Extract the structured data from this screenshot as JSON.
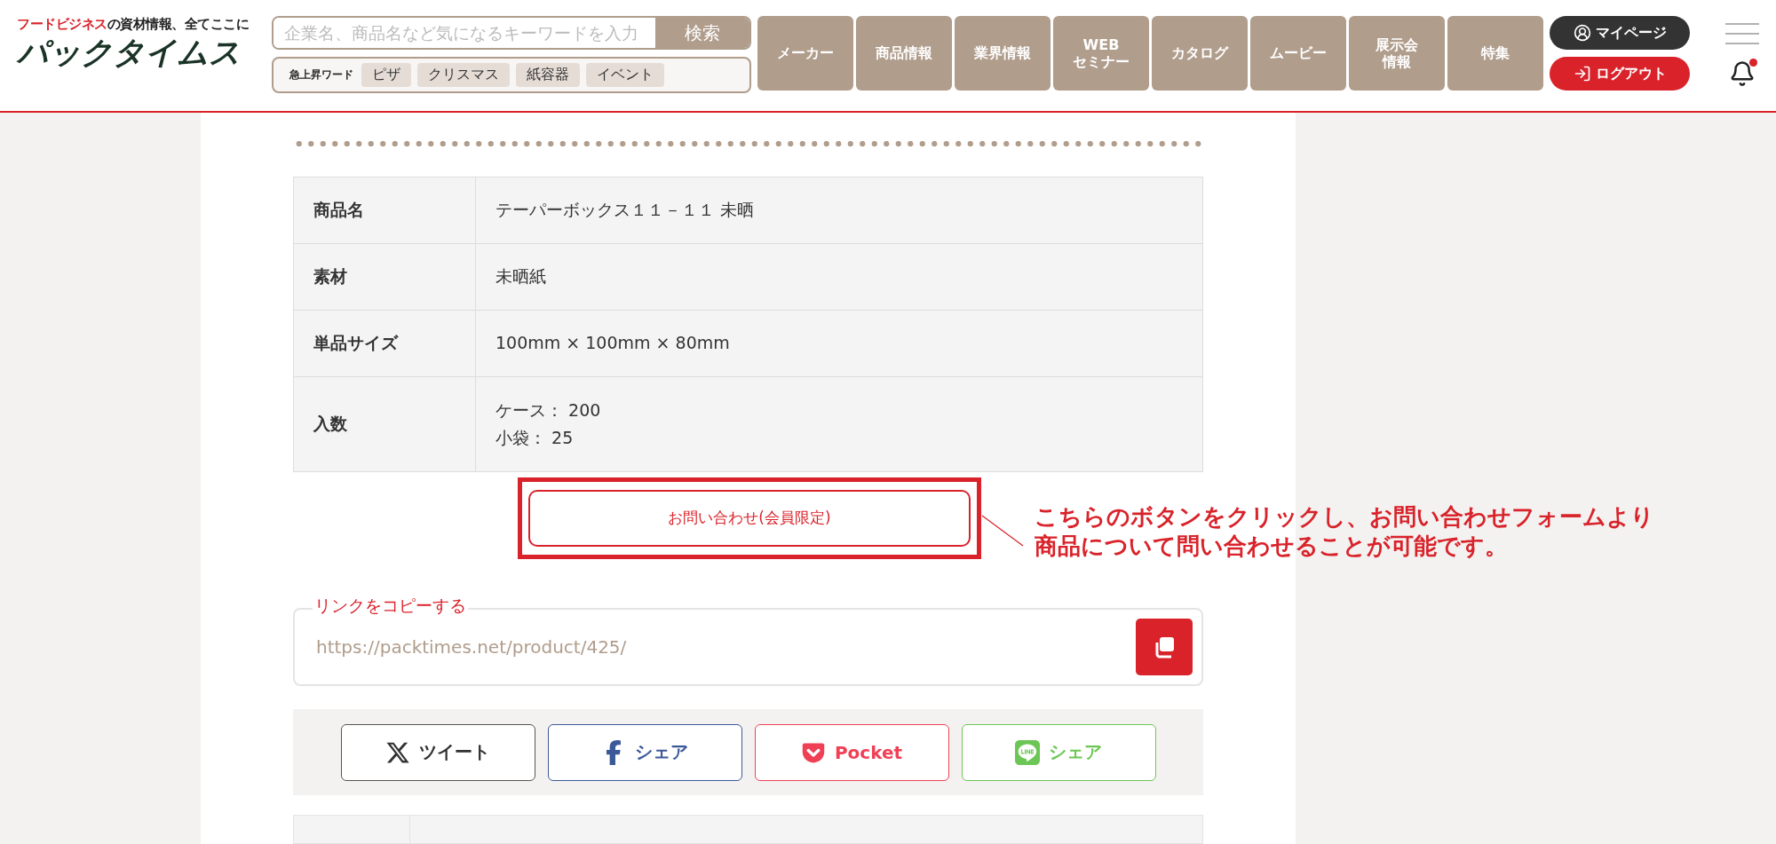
{
  "header": {
    "logo": {
      "tagline_accent": "フードビジネス",
      "tagline_rest": "の資材情報、全てここに",
      "name": "パックタイムス"
    },
    "search": {
      "placeholder": "企業名、商品名など気になるキーワードを入力",
      "button": "検索"
    },
    "trending": {
      "label": "急上昇ワード",
      "words": [
        "ピザ",
        "クリスマス",
        "紙容器",
        "イベント"
      ]
    },
    "nav": [
      [
        "メーカー"
      ],
      [
        "商品情報"
      ],
      [
        "業界情報"
      ],
      [
        "WEB",
        "セミナー"
      ],
      [
        "カタログ"
      ],
      [
        "ムービー"
      ],
      [
        "展示会",
        "情報"
      ],
      [
        "特集"
      ]
    ],
    "mypage": "マイページ",
    "logout": "ログアウト",
    "notification_unread": true
  },
  "details": [
    {
      "label": "商品名",
      "lines": [
        "テーパーボックス１１－１１ 未晒"
      ]
    },
    {
      "label": "素材",
      "lines": [
        "未晒紙"
      ]
    },
    {
      "label": "単品サイズ",
      "lines": [
        "100mm × 100mm × 80mm"
      ]
    },
    {
      "label": "入数",
      "lines": [
        "ケース： 200",
        "小袋： 25"
      ]
    }
  ],
  "inquiry_button": "お問い合わせ(会員限定)",
  "annotation": [
    "こちらのボタンをクリックし、お問い合わせフォームより",
    "商品について問い合わせることが可能です。"
  ],
  "copy_link": {
    "label": "リンクをコピーする",
    "value": "https://packtimes.net/product/425/"
  },
  "share": [
    {
      "kind": "x",
      "label": "ツイート"
    },
    {
      "kind": "facebook",
      "label": "シェア"
    },
    {
      "kind": "pocket",
      "label": "Pocket"
    },
    {
      "kind": "line",
      "label": "シェア"
    }
  ]
}
